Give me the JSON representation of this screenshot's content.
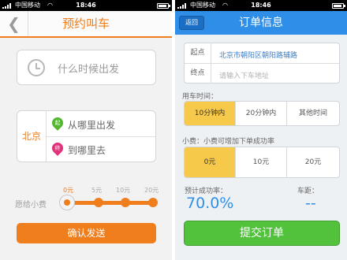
{
  "status": {
    "carrier": "中国移动",
    "time": "18:46"
  },
  "left": {
    "title": "预约叫车",
    "time_prompt": "什么时候出发",
    "city": "北京",
    "from_label": "从哪里出发",
    "to_label": "到哪里去",
    "start_pin": "起",
    "end_pin": "终",
    "tip_label": "愿给小费",
    "tip_marks": [
      "0元",
      "5元",
      "10元",
      "20元"
    ],
    "tip_selected": "0元",
    "confirm": "确认发送"
  },
  "right": {
    "back": "返回",
    "title": "订单信息",
    "start_label": "起点",
    "start_value": "北京市朝阳区朝阳路辅路",
    "end_label": "终点",
    "end_placeholder": "请输入下车地址",
    "time_label": "用车时间：",
    "time_options": [
      "10分钟内",
      "20分钟内",
      "其他时间"
    ],
    "time_selected": "10分钟内",
    "tip_label": "小费：小费可增加下单成功率",
    "tip_options": [
      "0元",
      "10元",
      "20元"
    ],
    "tip_selected": "0元",
    "rate_label": "预计成功率：",
    "rate_value": "70.0%",
    "distance_label": "车距：",
    "distance_value": "--",
    "submit": "提交订单"
  },
  "colors": {
    "orange": "#f07e1c",
    "blue": "#2f8fe8",
    "green": "#52c23d",
    "yellow": "#f6c94a"
  },
  "icons": [
    "back-arrow-icon",
    "clock-icon",
    "start-pin-icon",
    "end-pin-icon",
    "signal-icon",
    "wifi-icon",
    "battery-icon"
  ]
}
